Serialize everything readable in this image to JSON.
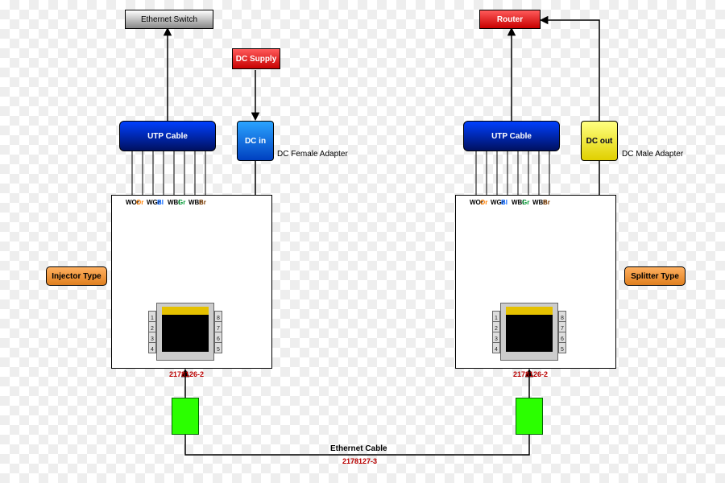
{
  "top": {
    "switch": "Ethernet Switch",
    "router": "Router",
    "dc_supply": "DC Supply"
  },
  "utp_left": "UTP Cable",
  "utp_right": "UTP Cable",
  "dc_in": "DC in",
  "dc_out": "DC out",
  "dc_female": "DC Female Adapter",
  "dc_male": "DC Male Adapter",
  "injector": "Injector Type",
  "splitter": "Splitter Type",
  "ethernet_cable": "Ethernet Cable",
  "part_conn": "2178126-2",
  "part_cable": "2178127-3",
  "wires": [
    {
      "t": "WOr",
      "c": "#000"
    },
    {
      "t": "Or",
      "c": "#ff7f00"
    },
    {
      "t": "WGr",
      "c": "#000"
    },
    {
      "t": "Bl",
      "c": "#0060ff"
    },
    {
      "t": "WBl",
      "c": "#000"
    },
    {
      "t": "Gr",
      "c": "#009933"
    },
    {
      "t": "WBr",
      "c": "#000"
    },
    {
      "t": "Br",
      "c": "#7a3b00"
    }
  ],
  "pins_left": [
    "1",
    "2",
    "3",
    "4"
  ],
  "pins_right": [
    "8",
    "7",
    "6",
    "5"
  ]
}
